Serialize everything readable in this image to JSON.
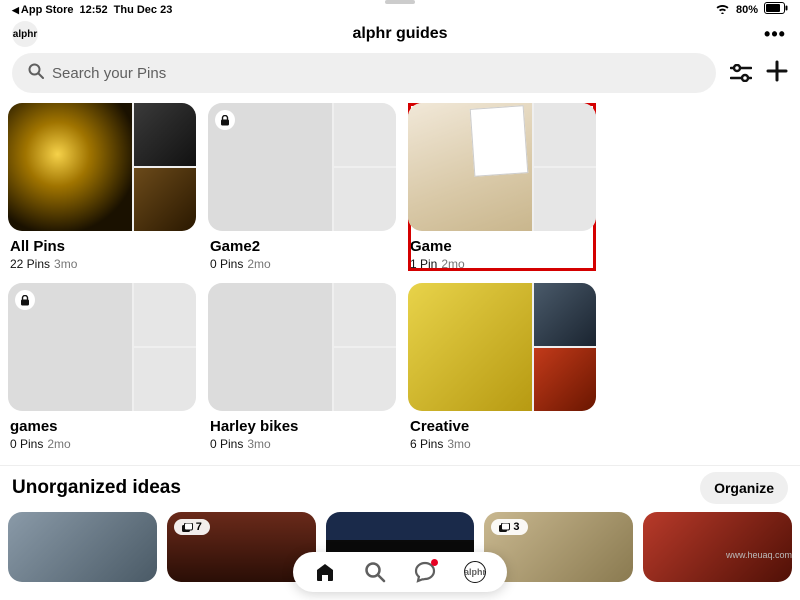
{
  "status": {
    "back_app": "App Store",
    "time": "12:52",
    "date": "Thu Dec 23",
    "battery_pct": "80%"
  },
  "header": {
    "avatar_label": "alphr",
    "title": "alphr guides"
  },
  "search": {
    "placeholder": "Search your Pins"
  },
  "boards": [
    {
      "title": "All Pins",
      "pins": "22 Pins",
      "age": "3mo",
      "locked": false,
      "cover": "cv-allpins"
    },
    {
      "title": "Game2",
      "pins": "0 Pins",
      "age": "2mo",
      "locked": true,
      "cover": ""
    },
    {
      "title": "Game",
      "pins": "1 Pin",
      "age": "2mo",
      "locked": true,
      "cover": "cv-game",
      "highlight": true
    },
    {
      "title": "games",
      "pins": "0 Pins",
      "age": "2mo",
      "locked": true,
      "cover": ""
    },
    {
      "title": "Harley bikes",
      "pins": "0 Pins",
      "age": "3mo",
      "locked": false,
      "cover": ""
    },
    {
      "title": "Creative",
      "pins": "6 Pins",
      "age": "3mo",
      "locked": false,
      "cover": "cv-creative"
    }
  ],
  "section": {
    "title": "Unorganized ideas",
    "organize": "Organize"
  },
  "ideas": [
    {
      "badge": ""
    },
    {
      "badge": "7"
    },
    {
      "badge": ""
    },
    {
      "badge": "3"
    },
    {
      "badge": ""
    }
  ],
  "nav": {
    "avatar": "alphr"
  },
  "watermark": "www.heuaq.com"
}
